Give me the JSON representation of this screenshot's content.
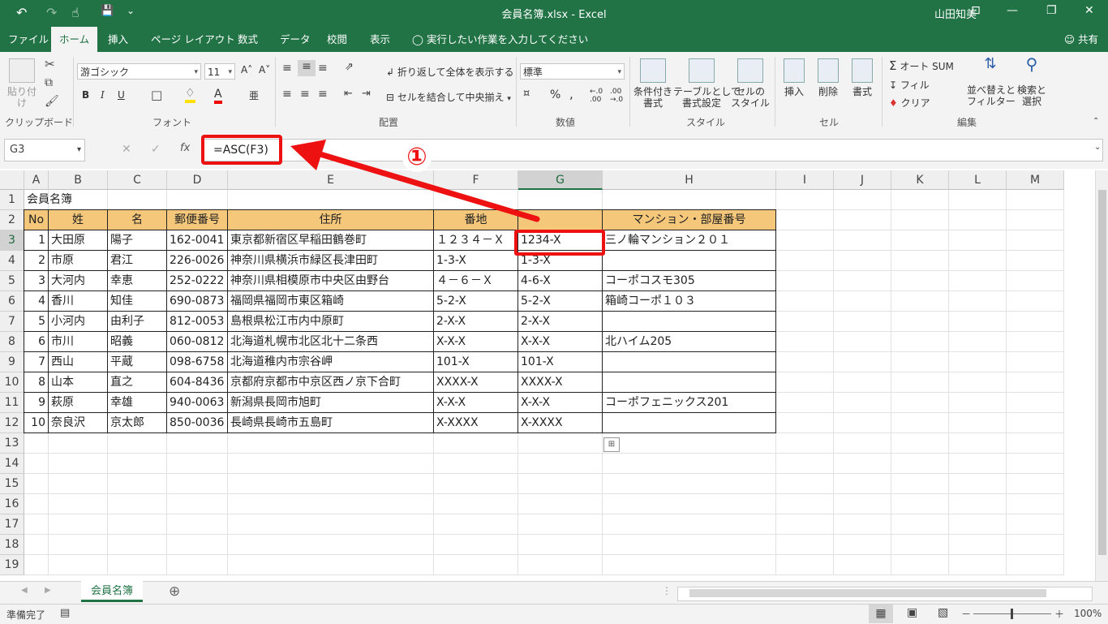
{
  "window": {
    "title": "会員名簿.xlsx  -  Excel",
    "user": "山田知美",
    "qat": {
      "undo": "↶",
      "redo": "↷",
      "touch": "☝",
      "save": "💾",
      "more": "⌄"
    },
    "controls": {
      "ribbon_opts": "⊡",
      "minimize": "—",
      "restore": "❐",
      "close": "✕"
    }
  },
  "tabs": [
    "ファイル",
    "ホーム",
    "挿入",
    "ページ レイアウト",
    "数式",
    "データ",
    "校閲",
    "表示"
  ],
  "tell_me": "実行したい作業を入力してください",
  "share": "共有",
  "ribbon": {
    "clipboard": {
      "paste": "貼り付け",
      "label": "クリップボード"
    },
    "font": {
      "name": "游ゴシック",
      "size": "11",
      "bold": "B",
      "italic": "I",
      "underline": "U",
      "grow": "A˄",
      "shrink": "A˅",
      "font_color": "A",
      "phonetic": "亜",
      "label": "フォント"
    },
    "align": {
      "wrap": "折り返して全体を表示する",
      "merge": "セルを結合して中央揃え",
      "label": "配置"
    },
    "number": {
      "format": "標準",
      "percent": "%",
      "comma": ",",
      "inc": "←.0 .00",
      "dec": ".00 →.0",
      "label": "数値"
    },
    "styles": {
      "cond": "条件付き\n書式",
      "table": "テーブルとして\n書式設定",
      "cell": "セルの\nスタイル",
      "label": "スタイル"
    },
    "cells": {
      "insert": "挿入",
      "delete": "削除",
      "format": "書式",
      "label": "セル"
    },
    "editing": {
      "autosum": "オート SUM",
      "fill": "フィル",
      "clear": "クリア",
      "sort": "並べ替えと\nフィルター",
      "find": "検索と\n選択",
      "label": "編集"
    }
  },
  "formula_bar": {
    "name_box": "G3",
    "cancel": "✕",
    "enter": "✓",
    "fx": "fx",
    "formula": "=ASC(F3)"
  },
  "annotation": {
    "step": "①"
  },
  "columns": [
    "A",
    "B",
    "C",
    "D",
    "E",
    "F",
    "G",
    "H",
    "I",
    "J",
    "K",
    "L",
    "M"
  ],
  "rows": [
    "1",
    "2",
    "3",
    "4",
    "5",
    "6",
    "7",
    "8",
    "9",
    "10",
    "11",
    "12",
    "13",
    "14",
    "15",
    "16",
    "17",
    "18",
    "19"
  ],
  "sheet": {
    "title": "会員名簿",
    "headers": [
      "No",
      "姓",
      "名",
      "郵便番号",
      "住所",
      "番地",
      "",
      "マンション・部屋番号"
    ],
    "records": [
      [
        "1",
        "大田原",
        "陽子",
        "162-0041",
        "東京都新宿区早稲田鶴巻町",
        "１２３４－Ｘ",
        "1234-X",
        "三ノ輪マンション２０１"
      ],
      [
        "2",
        "市原",
        "君江",
        "226-0026",
        "神奈川県横浜市緑区長津田町",
        "1-3-X",
        "1-3-X",
        ""
      ],
      [
        "3",
        "大河内",
        "幸恵",
        "252-0222",
        "神奈川県相模原市中央区由野台",
        "４－６－Ｘ",
        "4-6-X",
        "コーポコスモ305"
      ],
      [
        "4",
        "香川",
        "知佳",
        "690-0873",
        "福岡県福岡市東区箱崎",
        "5-2-X",
        "5-2-X",
        "箱崎コーポ１０３"
      ],
      [
        "5",
        "小河内",
        "由利子",
        "812-0053",
        "島根県松江市内中原町",
        "2-X-X",
        "2-X-X",
        ""
      ],
      [
        "6",
        "市川",
        "昭義",
        "060-0812",
        "北海道札幌市北区北十二条西",
        "X-X-X",
        "X-X-X",
        "北ハイム205"
      ],
      [
        "7",
        "西山",
        "平蔵",
        "098-6758",
        "北海道稚内市宗谷岬",
        "101-X",
        "101-X",
        ""
      ],
      [
        "8",
        "山本",
        "直之",
        "604-8436",
        "京都府京都市中京区西ノ京下合町",
        "XXXX-X",
        "XXXX-X",
        ""
      ],
      [
        "9",
        "萩原",
        "幸雄",
        "940-0063",
        "新潟県長岡市旭町",
        "X-X-X",
        "X-X-X",
        "コーポフェニックス201"
      ],
      [
        "10",
        "奈良沢",
        "京太郎",
        "850-0036",
        "長崎県長崎市五島町",
        "X-XXXX",
        "X-XXXX",
        ""
      ]
    ]
  },
  "sheet_tabs": [
    "会員名簿"
  ],
  "add_sheet": "⊕",
  "status": {
    "ready": "準備完了",
    "zoom": "100%",
    "minus": "－",
    "plus": "＋"
  },
  "colors": {
    "excel_green": "#217346",
    "header_fill": "#F4C77A",
    "highlight_red": "#EE1111"
  }
}
